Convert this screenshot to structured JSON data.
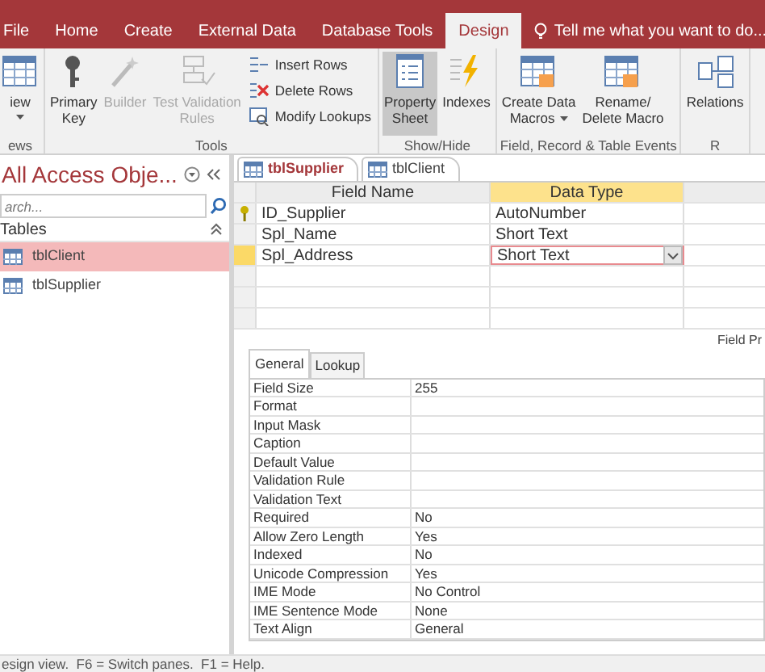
{
  "app_tabs": [
    {
      "label": "File",
      "selected": false
    },
    {
      "label": "Home",
      "selected": false
    },
    {
      "label": "Create",
      "selected": false
    },
    {
      "label": "External Data",
      "selected": false
    },
    {
      "label": "Database Tools",
      "selected": false
    },
    {
      "label": "Design",
      "selected": true
    }
  ],
  "tell_me": {
    "text": "Tell me what you want to do..."
  },
  "ribbon_groups": [
    {
      "label": "ews",
      "commands": [
        {
          "kind": "large",
          "lines": [
            "iew"
          ],
          "menu": true,
          "disabled": false,
          "on": false
        }
      ]
    },
    {
      "label": "Tools",
      "commands": [
        {
          "kind": "large",
          "lines": [
            "Primary",
            "Key"
          ],
          "menu": false,
          "disabled": false,
          "on": false
        },
        {
          "kind": "large",
          "lines": [
            "Builder"
          ],
          "menu": false,
          "disabled": true,
          "on": false
        },
        {
          "kind": "large",
          "lines": [
            "Test Validation",
            "Rules"
          ],
          "menu": false,
          "disabled": true,
          "on": false
        },
        {
          "kind": "small",
          "lines": [
            "Insert Rows"
          ]
        },
        {
          "kind": "small",
          "lines": [
            "Delete Rows"
          ]
        },
        {
          "kind": "small",
          "lines": [
            "Modify Lookups"
          ]
        }
      ]
    },
    {
      "label": "Show/Hide",
      "commands": [
        {
          "kind": "large",
          "lines": [
            "Property",
            "Sheet"
          ],
          "menu": false,
          "disabled": false,
          "on": true
        },
        {
          "kind": "large",
          "lines": [
            "Indexes"
          ],
          "menu": false,
          "disabled": false,
          "on": false
        }
      ]
    },
    {
      "label": "Field, Record & Table Events",
      "commands": [
        {
          "kind": "large",
          "lines": [
            "Create Data",
            "Macros"
          ],
          "menu": true,
          "disabled": false,
          "on": false
        },
        {
          "kind": "large",
          "lines": [
            "Rename/",
            "Delete Macro"
          ],
          "menu": false,
          "disabled": false,
          "on": false
        }
      ]
    },
    {
      "label": "R",
      "commands": [
        {
          "kind": "large",
          "lines": [
            "Relations"
          ],
          "menu": false,
          "disabled": false,
          "on": false
        }
      ]
    }
  ],
  "nav_pane": {
    "title": "All Access Obje...",
    "search": {
      "placeholder": "arch..."
    },
    "section": "Tables",
    "items": [
      {
        "label": "tblClient",
        "selected": true
      },
      {
        "label": "tblSupplier",
        "selected": false
      }
    ]
  },
  "doc_tabs": [
    {
      "label": "tblSupplier",
      "selected": true
    },
    {
      "label": "tblClient",
      "selected": false
    }
  ],
  "design_grid": {
    "columns": [
      "Field Name",
      "Data Type"
    ],
    "rows": [
      {
        "field_name": "ID_Supplier",
        "data_type": "AutoNumber",
        "primary_key": true,
        "selected": false
      },
      {
        "field_name": "Spl_Name",
        "data_type": "Short Text",
        "primary_key": false,
        "selected": false
      },
      {
        "field_name": "Spl_Address",
        "data_type": "Short Text",
        "primary_key": false,
        "selected": true
      }
    ]
  },
  "field_properties": {
    "title": "Field Pr",
    "tabs": [
      {
        "label": "General",
        "selected": true
      },
      {
        "label": "Lookup",
        "selected": false
      }
    ],
    "rows": [
      {
        "label": "Field Size",
        "value": "255"
      },
      {
        "label": "Format",
        "value": ""
      },
      {
        "label": "Input Mask",
        "value": ""
      },
      {
        "label": "Caption",
        "value": ""
      },
      {
        "label": "Default Value",
        "value": ""
      },
      {
        "label": "Validation Rule",
        "value": ""
      },
      {
        "label": "Validation Text",
        "value": ""
      },
      {
        "label": "Required",
        "value": "No"
      },
      {
        "label": "Allow Zero Length",
        "value": "Yes"
      },
      {
        "label": "Indexed",
        "value": "No"
      },
      {
        "label": "Unicode Compression",
        "value": "Yes"
      },
      {
        "label": "IME Mode",
        "value": "No Control"
      },
      {
        "label": "IME Sentence Mode",
        "value": "None"
      },
      {
        "label": "Text Align",
        "value": "General"
      }
    ]
  },
  "status_bar": "esign view.  F6 = Switch panes.  F1 = Help."
}
